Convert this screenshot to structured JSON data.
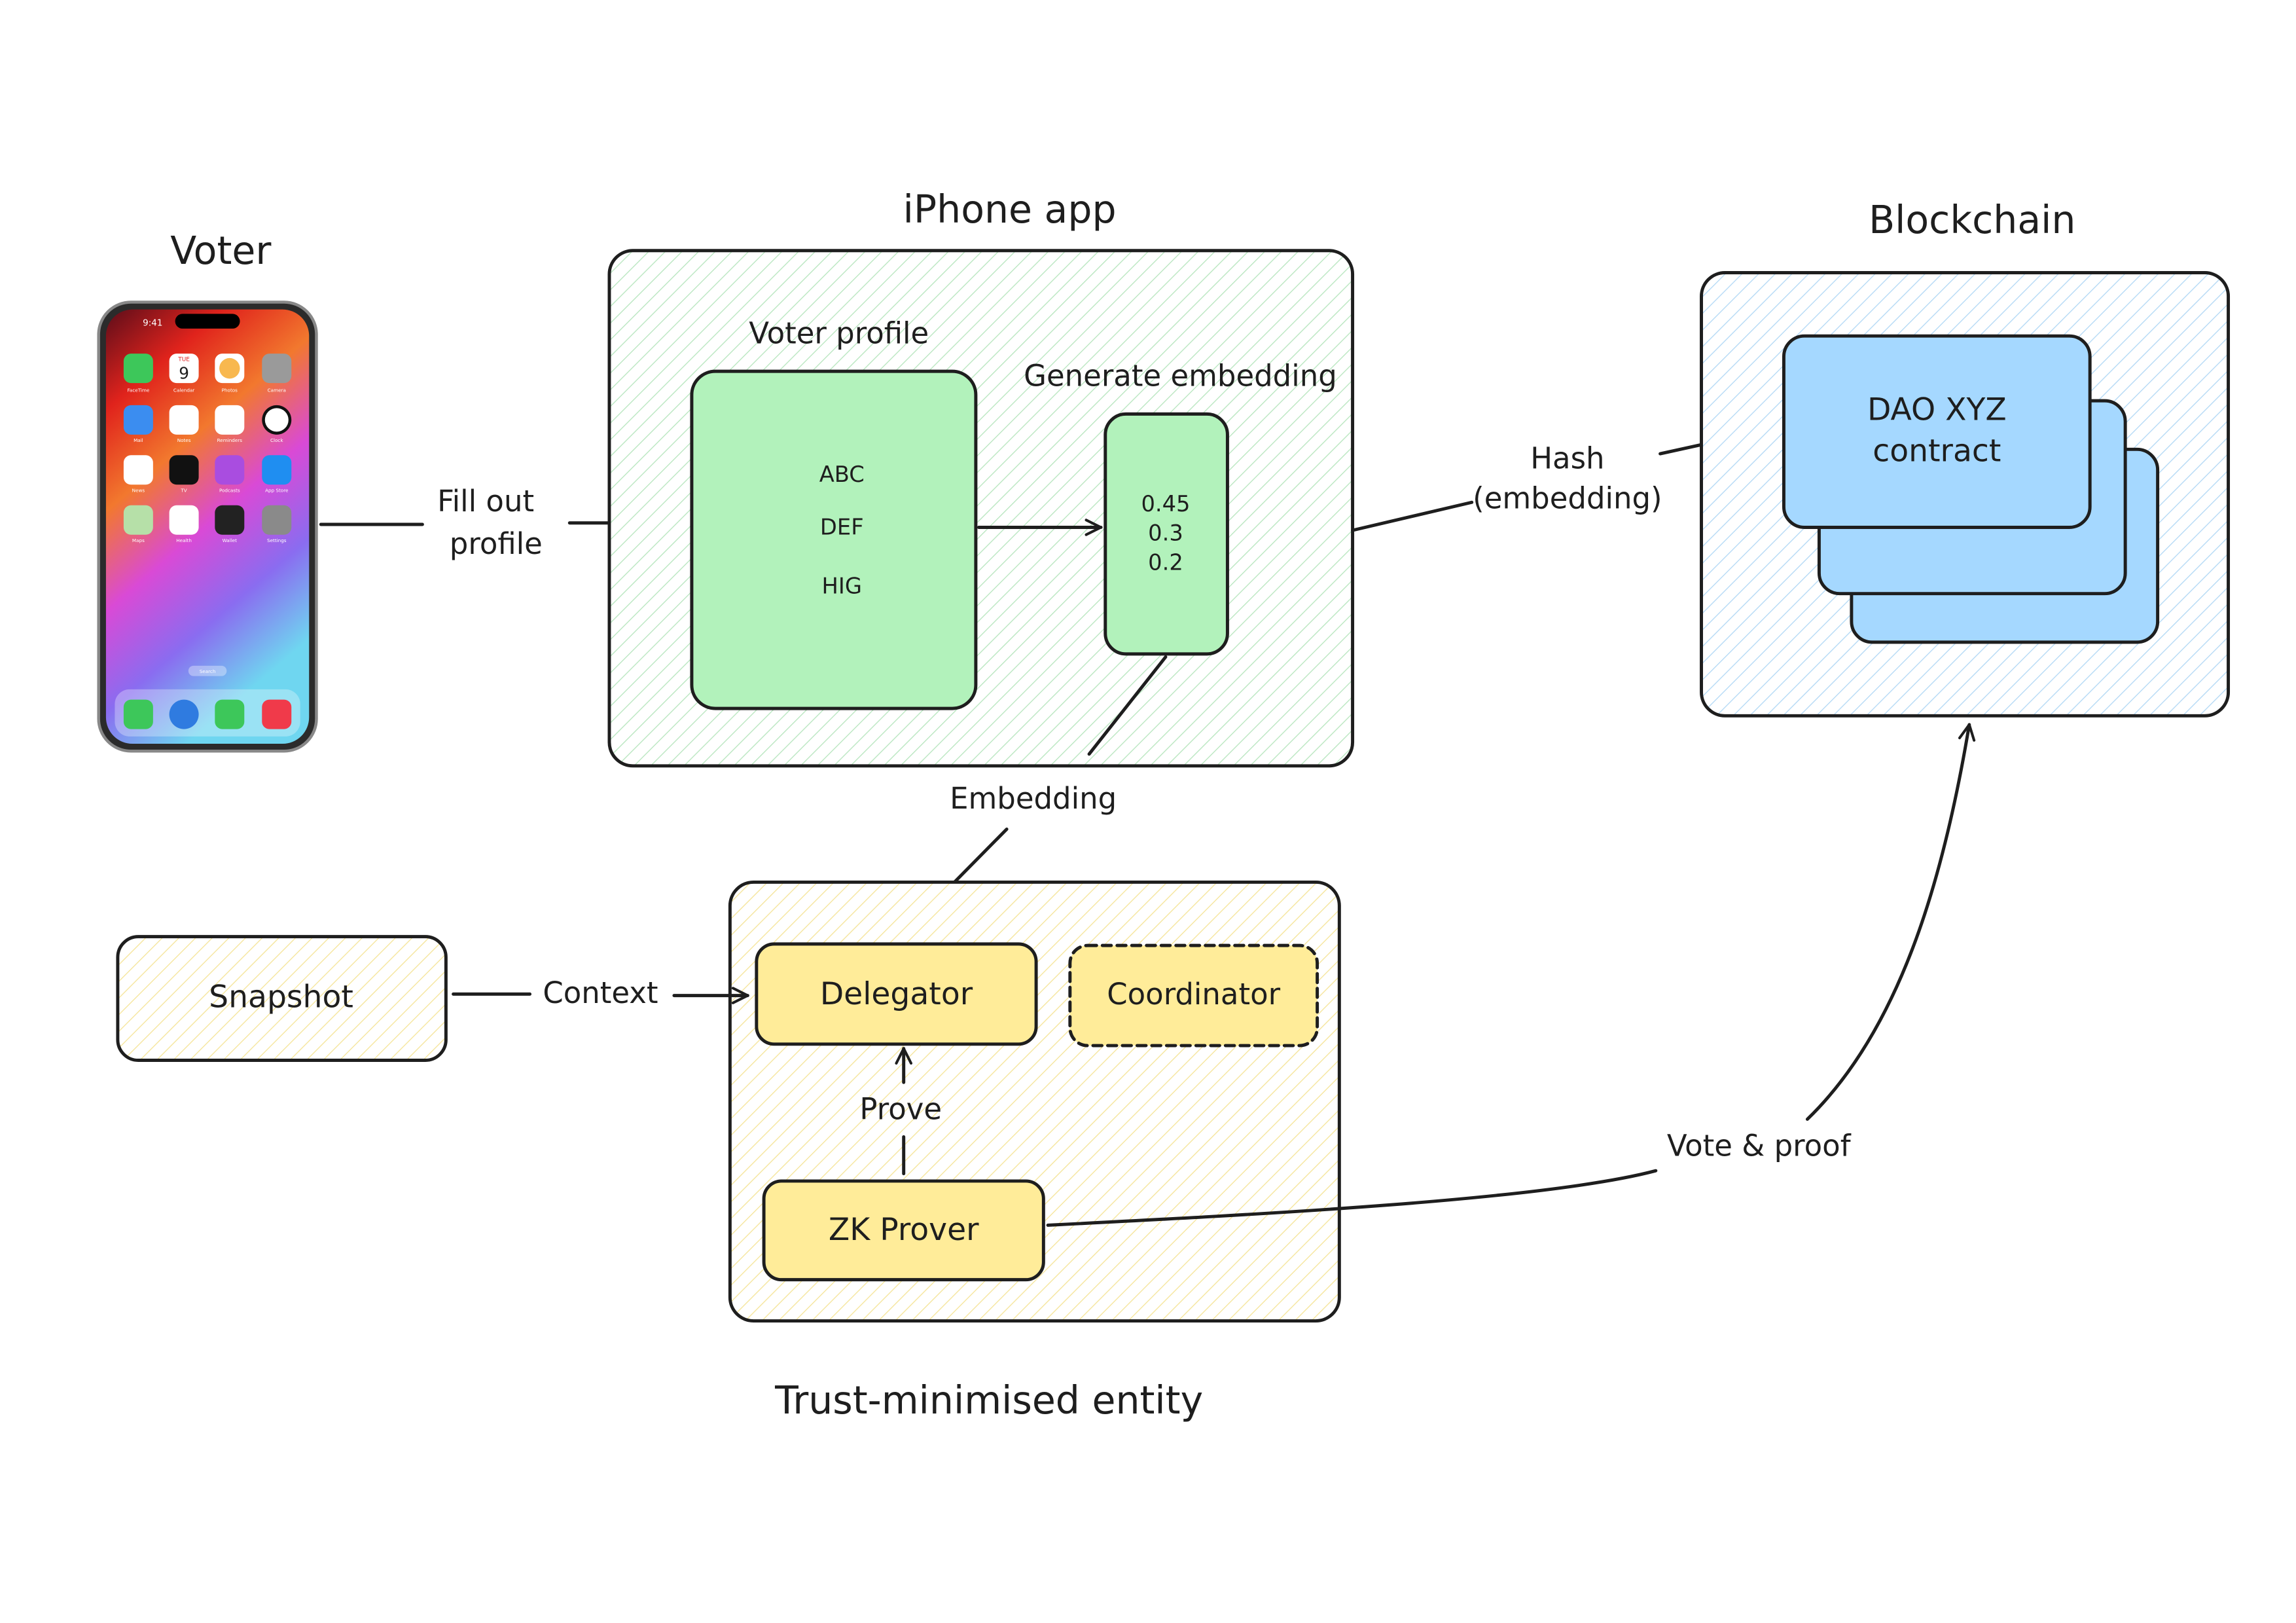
{
  "colors": {
    "iphone_app_fill": "#b2f2bb",
    "iphone_app_hatch": "#8fd49a",
    "blockchain_fill": "#a5d8ff",
    "blockchain_hatch": "#8ec2ea",
    "trust_fill": "#ffec99",
    "trust_hatch": "#f2dc7a",
    "stroke": "#1e1e1e"
  },
  "voter": {
    "title": "Voter",
    "phone": {
      "time": "9:41",
      "calendar_day": "TUE",
      "calendar_date": "9",
      "search": "Search",
      "apps": [
        "FaceTime",
        "Calendar",
        "Photos",
        "Camera",
        "Mail",
        "Notes",
        "Reminders",
        "Clock",
        "News",
        "TV",
        "Podcasts",
        "App Store",
        "Maps",
        "Health",
        "Wallet",
        "Settings"
      ],
      "dock": [
        "phone-icon",
        "safari-icon",
        "messages-icon",
        "music-icon"
      ]
    }
  },
  "edges": {
    "fill_out_1": "Fill out",
    "fill_out_2": "profile",
    "hash_1": "Hash",
    "hash_2": "(embedding)",
    "embedding": "Embedding",
    "context": "Context",
    "prove": "Prove",
    "vote_proof": "Vote & proof"
  },
  "iphone_app": {
    "title": "iPhone app",
    "voter_profile": {
      "label": "Voter profile",
      "items": [
        "ABC",
        "DEF",
        "HIG"
      ]
    },
    "generate_embedding": {
      "label": "Generate embedding",
      "values": [
        "0.45",
        "0.3",
        "0.2"
      ]
    }
  },
  "blockchain": {
    "title": "Blockchain",
    "contract_line1": "DAO XYZ",
    "contract_line2": "contract"
  },
  "snapshot": {
    "label": "Snapshot"
  },
  "trust_entity": {
    "title": "Trust-minimised entity",
    "delegator": "Delegator",
    "coordinator": "Coordinator",
    "zk_prover": "ZK Prover"
  }
}
